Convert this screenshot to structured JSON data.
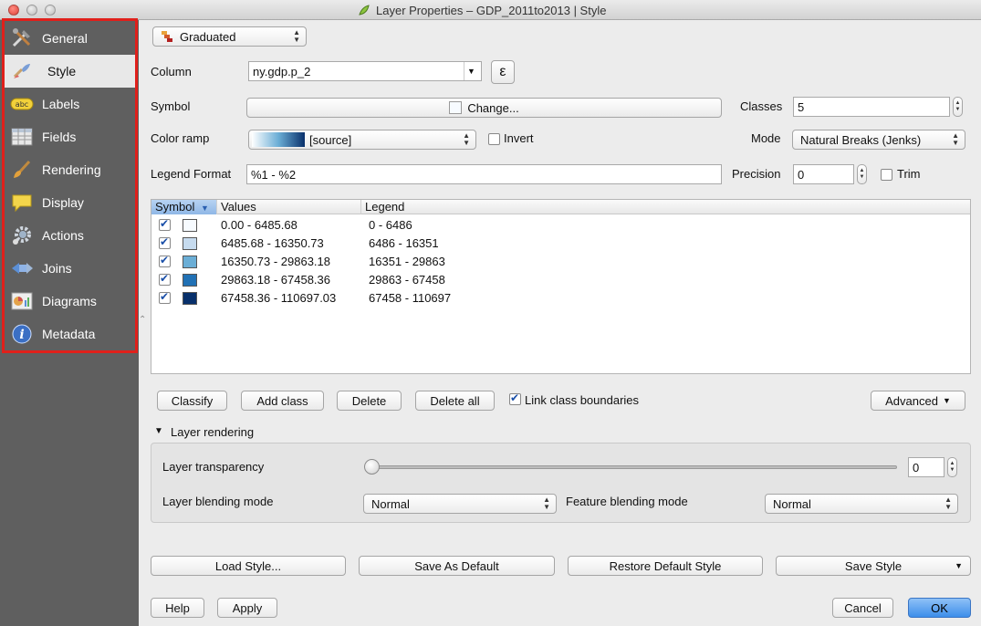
{
  "window": {
    "title": "Layer Properties – GDP_2011to2013 | Style"
  },
  "sidebar": {
    "items": [
      {
        "label": "General",
        "icon": "hammer-wrench-icon"
      },
      {
        "label": "Style",
        "icon": "paintbrush-icon"
      },
      {
        "label": "Labels",
        "icon": "abc-label-icon"
      },
      {
        "label": "Fields",
        "icon": "table-fields-icon"
      },
      {
        "label": "Rendering",
        "icon": "brush-icon"
      },
      {
        "label": "Display",
        "icon": "speech-bubble-icon"
      },
      {
        "label": "Actions",
        "icon": "gear-icon"
      },
      {
        "label": "Joins",
        "icon": "joins-icon"
      },
      {
        "label": "Diagrams",
        "icon": "diagram-icon"
      },
      {
        "label": "Metadata",
        "icon": "info-icon"
      }
    ],
    "selected": "Style"
  },
  "renderer": {
    "type_label": "Graduated"
  },
  "form": {
    "column_label": "Column",
    "column_value": "ny.gdp.p_2",
    "expression_button": "ε",
    "symbol_label": "Symbol",
    "symbol_change_label": "Change...",
    "classes_label": "Classes",
    "classes_value": "5",
    "color_ramp_label": "Color ramp",
    "color_ramp_value": "[source]",
    "invert_label": "Invert",
    "invert_checked": false,
    "mode_label": "Mode",
    "mode_value": "Natural Breaks (Jenks)",
    "legend_format_label": "Legend Format",
    "legend_format_value": "%1 - %2",
    "precision_label": "Precision",
    "precision_value": "0",
    "trim_label": "Trim",
    "trim_checked": false
  },
  "table": {
    "headers": {
      "symbol": "Symbol",
      "values": "Values",
      "legend": "Legend"
    },
    "rows": [
      {
        "checked": true,
        "color": "#f7fbff",
        "values": "0.00 - 6485.68",
        "legend": "0 - 6486"
      },
      {
        "checked": true,
        "color": "#c6dbef",
        "values": "6485.68 - 16350.73",
        "legend": "6486 - 16351"
      },
      {
        "checked": true,
        "color": "#6baed6",
        "values": "16350.73 - 29863.18",
        "legend": "16351 - 29863"
      },
      {
        "checked": true,
        "color": "#2171b5",
        "values": "29863.18 - 67458.36",
        "legend": "29863 - 67458"
      },
      {
        "checked": true,
        "color": "#08306b",
        "values": "67458.36 - 110697.03",
        "legend": "67458 - 110697"
      }
    ]
  },
  "class_buttons": {
    "classify": "Classify",
    "add_class": "Add class",
    "delete": "Delete",
    "delete_all": "Delete all",
    "link_boundaries": "Link class boundaries",
    "link_checked": true,
    "advanced": "Advanced"
  },
  "layer_rendering": {
    "title": "Layer rendering",
    "transparency_label": "Layer transparency",
    "transparency_value": "0",
    "layer_blend_label": "Layer blending mode",
    "layer_blend_value": "Normal",
    "feature_blend_label": "Feature blending mode",
    "feature_blend_value": "Normal"
  },
  "style_buttons": {
    "load": "Load Style...",
    "save_default": "Save As Default",
    "restore_default": "Restore Default Style",
    "save_style": "Save Style"
  },
  "footer": {
    "help": "Help",
    "apply": "Apply",
    "cancel": "Cancel",
    "ok": "OK"
  }
}
